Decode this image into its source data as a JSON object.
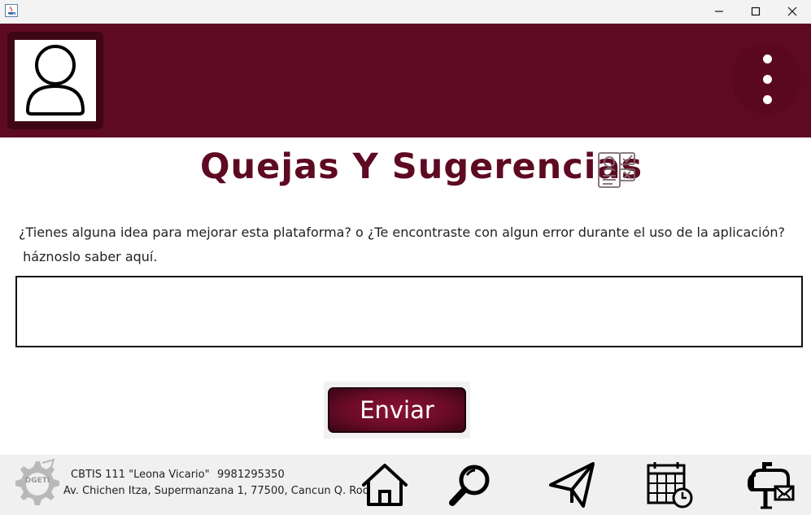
{
  "window": {
    "controls": [
      "minimize-icon",
      "maximize-icon",
      "close-icon"
    ]
  },
  "header": {
    "background": "#5e0a23",
    "avatar_icon": "user-icon",
    "menu_icon": "vertical-dots-icon"
  },
  "main": {
    "title": "Quejas Y Sugerencias",
    "title_color": "#5e0a23",
    "title_icon": "feedback-form-icon",
    "prompt_line1": "¿Tienes alguna idea para mejorar esta plataforma? o ¿Te encontraste con algun error durante el uso de la aplicación?",
    "prompt_line2": " háznoslo saber aquí.",
    "input_value": "",
    "send_label": "Enviar"
  },
  "footer": {
    "logo_text": "DGETI",
    "school": "CBTIS 111 \"Leona Vicario\"",
    "phone": "9981295350",
    "address": "Av. Chichen Itza, Supermanzana 1, 77500, Cancun Q. Roo",
    "nav": [
      "home-icon",
      "search-icon",
      "send-icon",
      "calendar-icon",
      "mailbox-icon"
    ]
  }
}
